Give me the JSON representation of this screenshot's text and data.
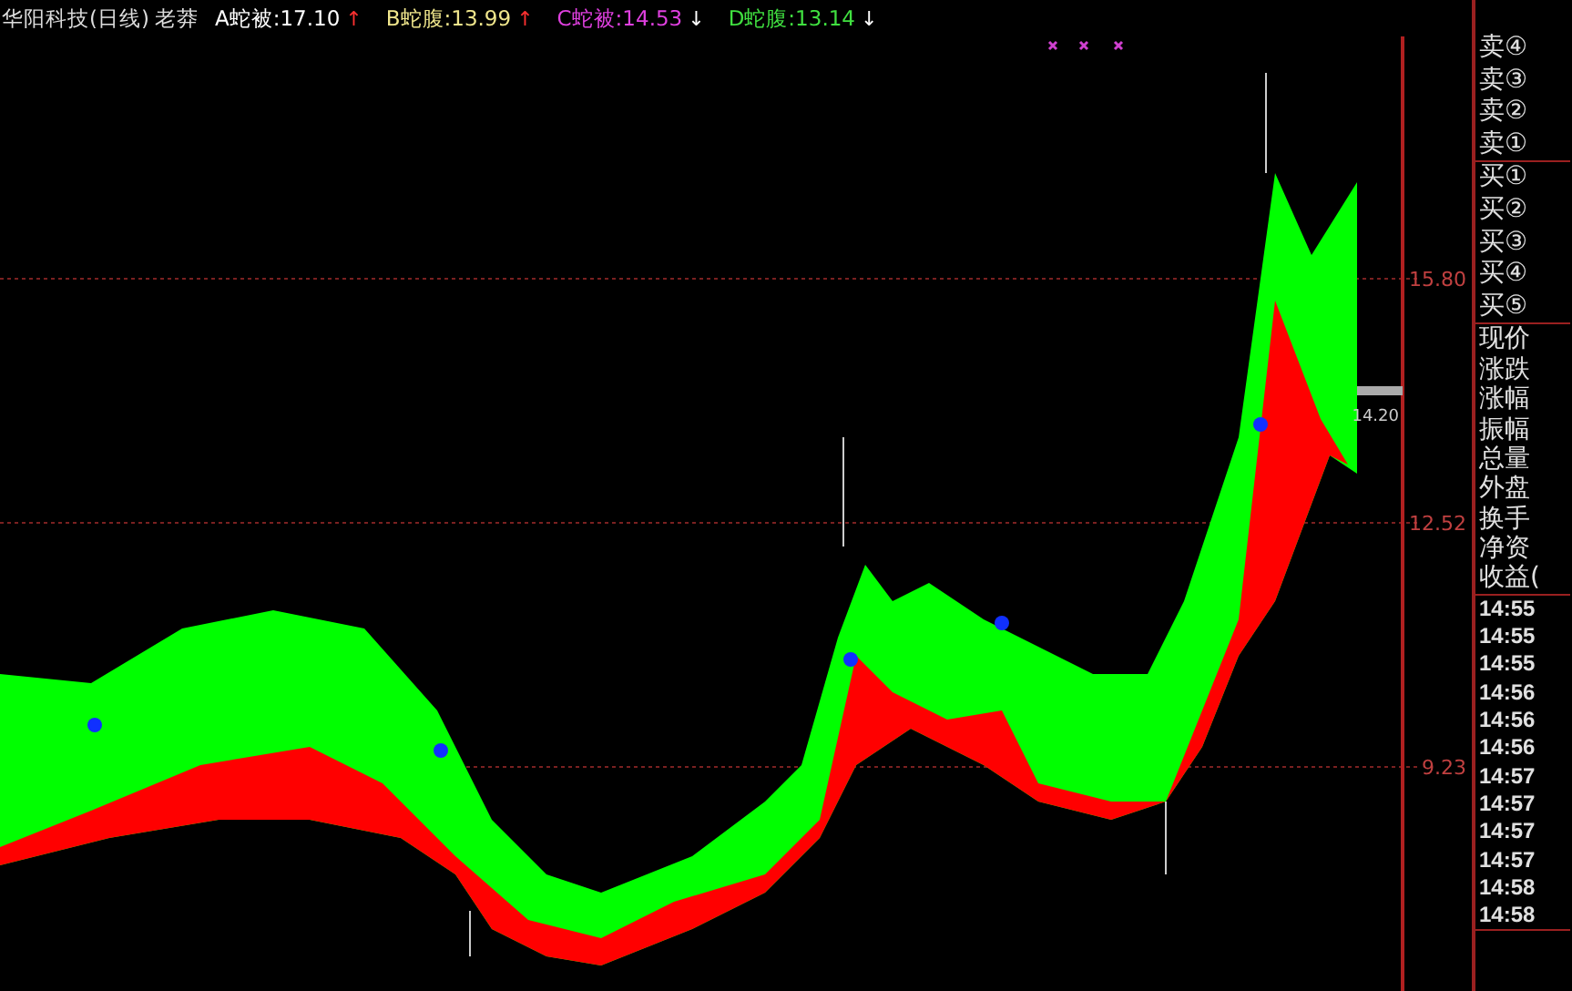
{
  "header": {
    "title": "华阳科技(日线)",
    "indicator": "老莽",
    "legend": [
      {
        "label": "A蛇被:17.10",
        "color": "#ffffff",
        "arrow": {
          "text": "↑",
          "color": "#ff3030"
        }
      },
      {
        "label": "B蛇腹:13.99",
        "color": "#f0e68c",
        "arrow": {
          "text": "↑",
          "color": "#ff3030"
        }
      },
      {
        "label": "C蛇被:14.53",
        "color": "#e040e0",
        "arrow": {
          "text": "↓",
          "color": "#ffffff"
        }
      },
      {
        "label": "D蛇腹:13.14",
        "color": "#40e040",
        "arrow": {
          "text": "↓",
          "color": "#ffffff"
        }
      }
    ]
  },
  "chart": {
    "price_labels": [
      "15.80",
      "12.52",
      "9.23"
    ],
    "last_price": "14.20"
  },
  "quote_panel": {
    "sell_levels": [
      "卖④",
      "卖③",
      "卖②",
      "卖①"
    ],
    "buy_levels": [
      "买①",
      "买②",
      "买③",
      "买④",
      "买⑤"
    ],
    "fields": [
      "现价",
      "涨跌",
      "涨幅",
      "振幅",
      "总量",
      "外盘",
      "换手",
      "净资",
      "收益("
    ],
    "times": [
      "14:55",
      "14:55",
      "14:55",
      "14:56",
      "14:56",
      "14:56",
      "14:57",
      "14:57",
      "14:57",
      "14:57",
      "14:58",
      "14:58"
    ]
  }
}
